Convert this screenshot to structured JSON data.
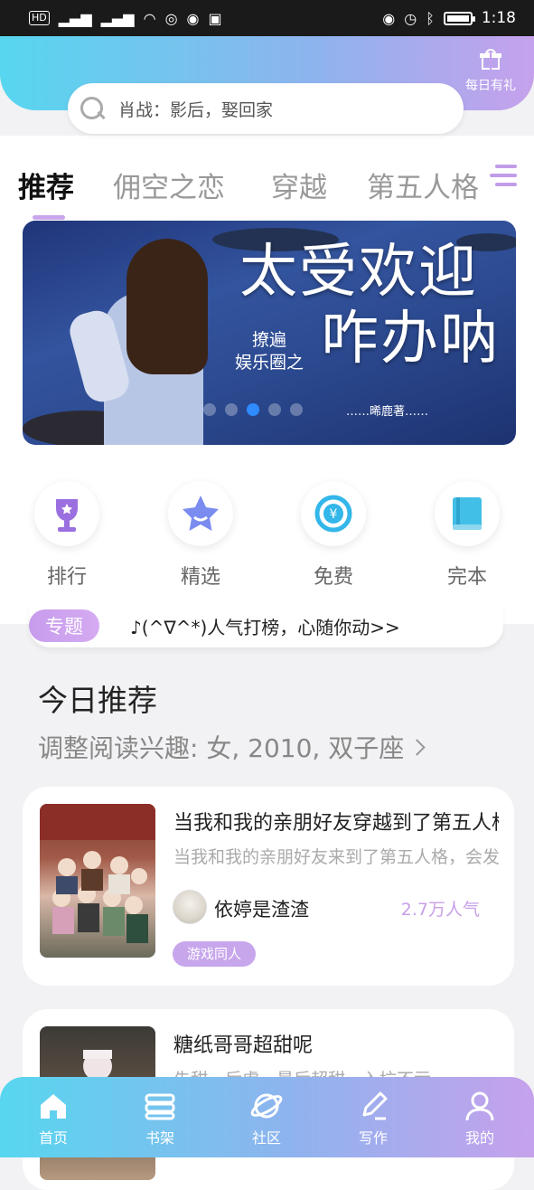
{
  "status_bar": {
    "net": "HD",
    "net2": "4G",
    "time": "1:18"
  },
  "header": {
    "gift_label": "每日有礼"
  },
  "search": {
    "placeholder": "肖战：影后，娶回家"
  },
  "tabs": [
    {
      "label": "推荐"
    },
    {
      "label": "佣空之恋"
    },
    {
      "label": "穿越"
    },
    {
      "label": "第五人格"
    }
  ],
  "banner": {
    "title_line1": "太受欢迎",
    "title_line2": "咋办呐",
    "subtitle_line1": "撩遍",
    "subtitle_line2": "娱乐圈之",
    "author": "……晞鹿著……",
    "dots": 5,
    "active_dot": 3
  },
  "categories": [
    {
      "label": "排行"
    },
    {
      "label": "精选"
    },
    {
      "label": "免费"
    },
    {
      "label": "完本"
    }
  ],
  "special": {
    "badge": "专题",
    "text": "♪(^∇^*)人气打榜，心随你动>>"
  },
  "section": {
    "title": "今日推荐",
    "subtitle": "调整阅读兴趣: 女, 2010, 双子座"
  },
  "books": [
    {
      "title": "当我和我的亲朋好友穿越到了第五人格",
      "desc": "当我和我的亲朋好友来到了第五人格，会发生什么",
      "author": "依婷是渣渣",
      "popularity": "2.7万人气",
      "tag": "游戏同人"
    },
    {
      "title": "糖纸哥哥超甜呢",
      "desc": "先甜，后虐，最后超甜，入坑不亏"
    }
  ],
  "bottom_nav": [
    {
      "label": "首页"
    },
    {
      "label": "书架"
    },
    {
      "label": "社区"
    },
    {
      "label": "写作"
    },
    {
      "label": "我的"
    }
  ]
}
